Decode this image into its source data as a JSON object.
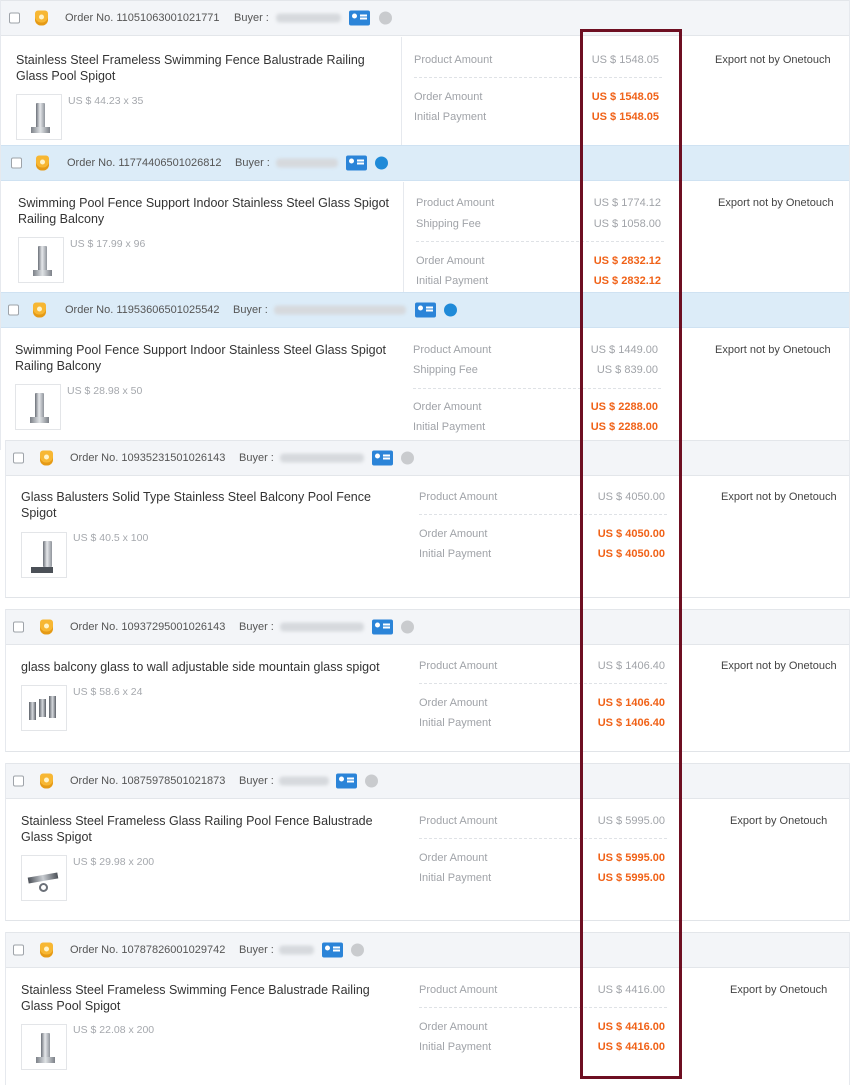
{
  "labels": {
    "order_no": "Order No.",
    "buyer": "Buyer :",
    "product_amount": "Product Amount",
    "shipping_fee": "Shipping Fee",
    "order_amount": "Order Amount",
    "initial_payment": "Initial Payment"
  },
  "orders": [
    {
      "order_no": "11051063001021771",
      "product_title": "Stainless Steel Frameless Swimming Fence Balustrade Railing Glass Pool Spigot",
      "unit_price": "US $ 44.23 x 35",
      "product_amount": "US $ 1548.05",
      "shipping_fee": "",
      "order_amount": "US $ 1548.05",
      "initial_payment": "US $ 1548.05",
      "export_status": "Export not by Onetouch"
    },
    {
      "order_no": "11774406501026812",
      "product_title": "Swimming Pool Fence Support Indoor Stainless Steel Glass Spigot Railing Balcony",
      "unit_price": "US $ 17.99 x 96",
      "product_amount": "US $ 1774.12",
      "shipping_fee": "US $ 1058.00",
      "order_amount": "US $ 2832.12",
      "initial_payment": "US $ 2832.12",
      "export_status": "Export not by Onetouch"
    },
    {
      "order_no": "11953606501025542",
      "product_title": "Swimming Pool Fence Support Indoor Stainless Steel Glass Spigot Railing Balcony",
      "unit_price": "US $ 28.98 x 50",
      "product_amount": "US $ 1449.00",
      "shipping_fee": "US $ 839.00",
      "order_amount": "US $ 2288.00",
      "initial_payment": "US $ 2288.00",
      "export_status": "Export not by Onetouch"
    },
    {
      "order_no": "10935231501026143",
      "product_title": "Glass Balusters Solid Type Stainless Steel Balcony Pool Fence Spigot",
      "unit_price": "US $ 40.5 x 100",
      "product_amount": "US $ 4050.00",
      "shipping_fee": "",
      "order_amount": "US $ 4050.00",
      "initial_payment": "US $ 4050.00",
      "export_status": "Export not by Onetouch"
    },
    {
      "order_no": "10937295001026143",
      "product_title": "glass balcony glass to wall adjustable side mountain glass spigot",
      "unit_price": "US $ 58.6 x 24",
      "product_amount": "US $ 1406.40",
      "shipping_fee": "",
      "order_amount": "US $ 1406.40",
      "initial_payment": "US $ 1406.40",
      "export_status": "Export not by Onetouch"
    },
    {
      "order_no": "10875978501021873",
      "product_title": "Stainless Steel Frameless Glass Railing Pool Fence Balustrade Glass Spigot",
      "unit_price": "US $ 29.98 x 200",
      "product_amount": "US $ 5995.00",
      "shipping_fee": "",
      "order_amount": "US $ 5995.00",
      "initial_payment": "US $ 5995.00",
      "export_status": "Export by Onetouch"
    },
    {
      "order_no": "10787826001029742",
      "product_title": "Stainless Steel Frameless Swimming Fence Balustrade Railing Glass Pool Spigot",
      "unit_price": "US $ 22.08 x 200",
      "product_amount": "US $ 4416.00",
      "shipping_fee": "",
      "order_amount": "US $ 4416.00",
      "initial_payment": "US $ 4416.00",
      "export_status": "Export by Onetouch"
    }
  ],
  "colors": {
    "accent_price": "#f06218",
    "highlight_box": "#6e0f22",
    "header_blue": "#dcecf8",
    "header_gray": "#f3f5f8",
    "contact_icon": "#2b84d8"
  },
  "icons": [
    "checkbox",
    "gold-supplier-medal-icon",
    "contact-card-icon",
    "chat-status-icon"
  ]
}
